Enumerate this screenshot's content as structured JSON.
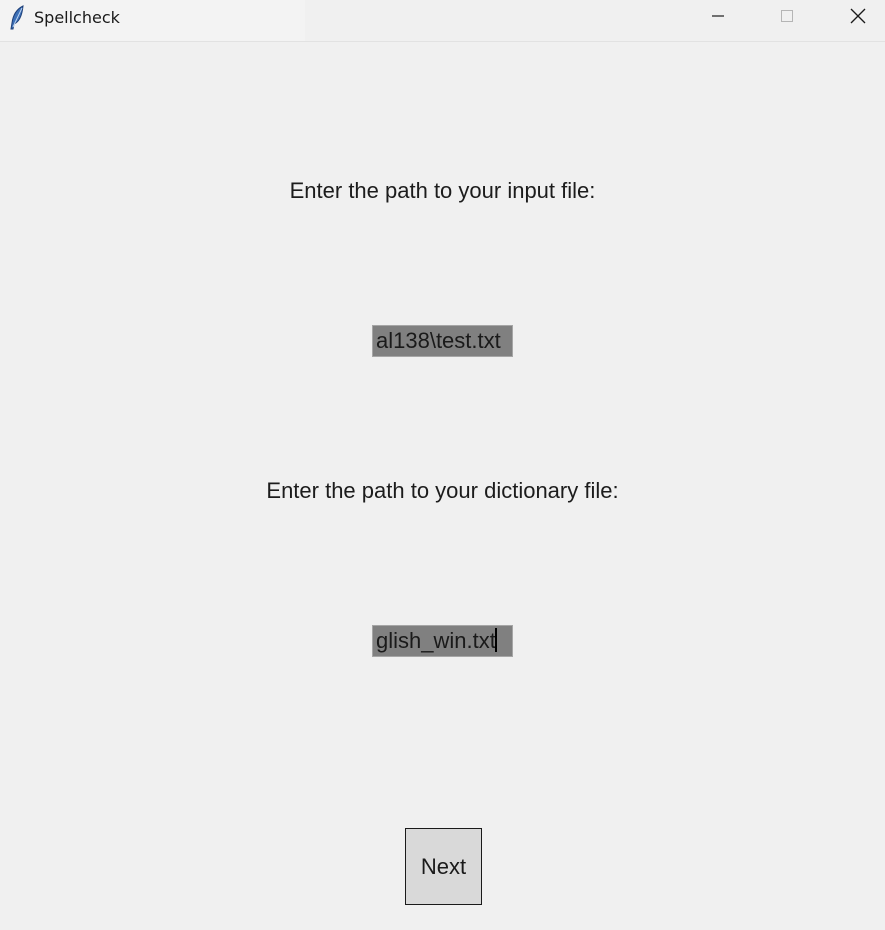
{
  "window": {
    "title": "Spellcheck",
    "icon": "feather-icon",
    "controls": {
      "minimize": "minimize-icon",
      "maximize": "maximize-icon",
      "close": "close-icon"
    }
  },
  "form": {
    "input_label": "Enter the path to your input file:",
    "input_value": "al138\\test.txt",
    "dictionary_label": "Enter the path to your dictionary file:",
    "dictionary_value": "glish_win.txt",
    "next_label": "Next"
  },
  "colors": {
    "background": "#f0f0f0",
    "entry_background": "#808080",
    "button_background": "#d9d9d9"
  }
}
